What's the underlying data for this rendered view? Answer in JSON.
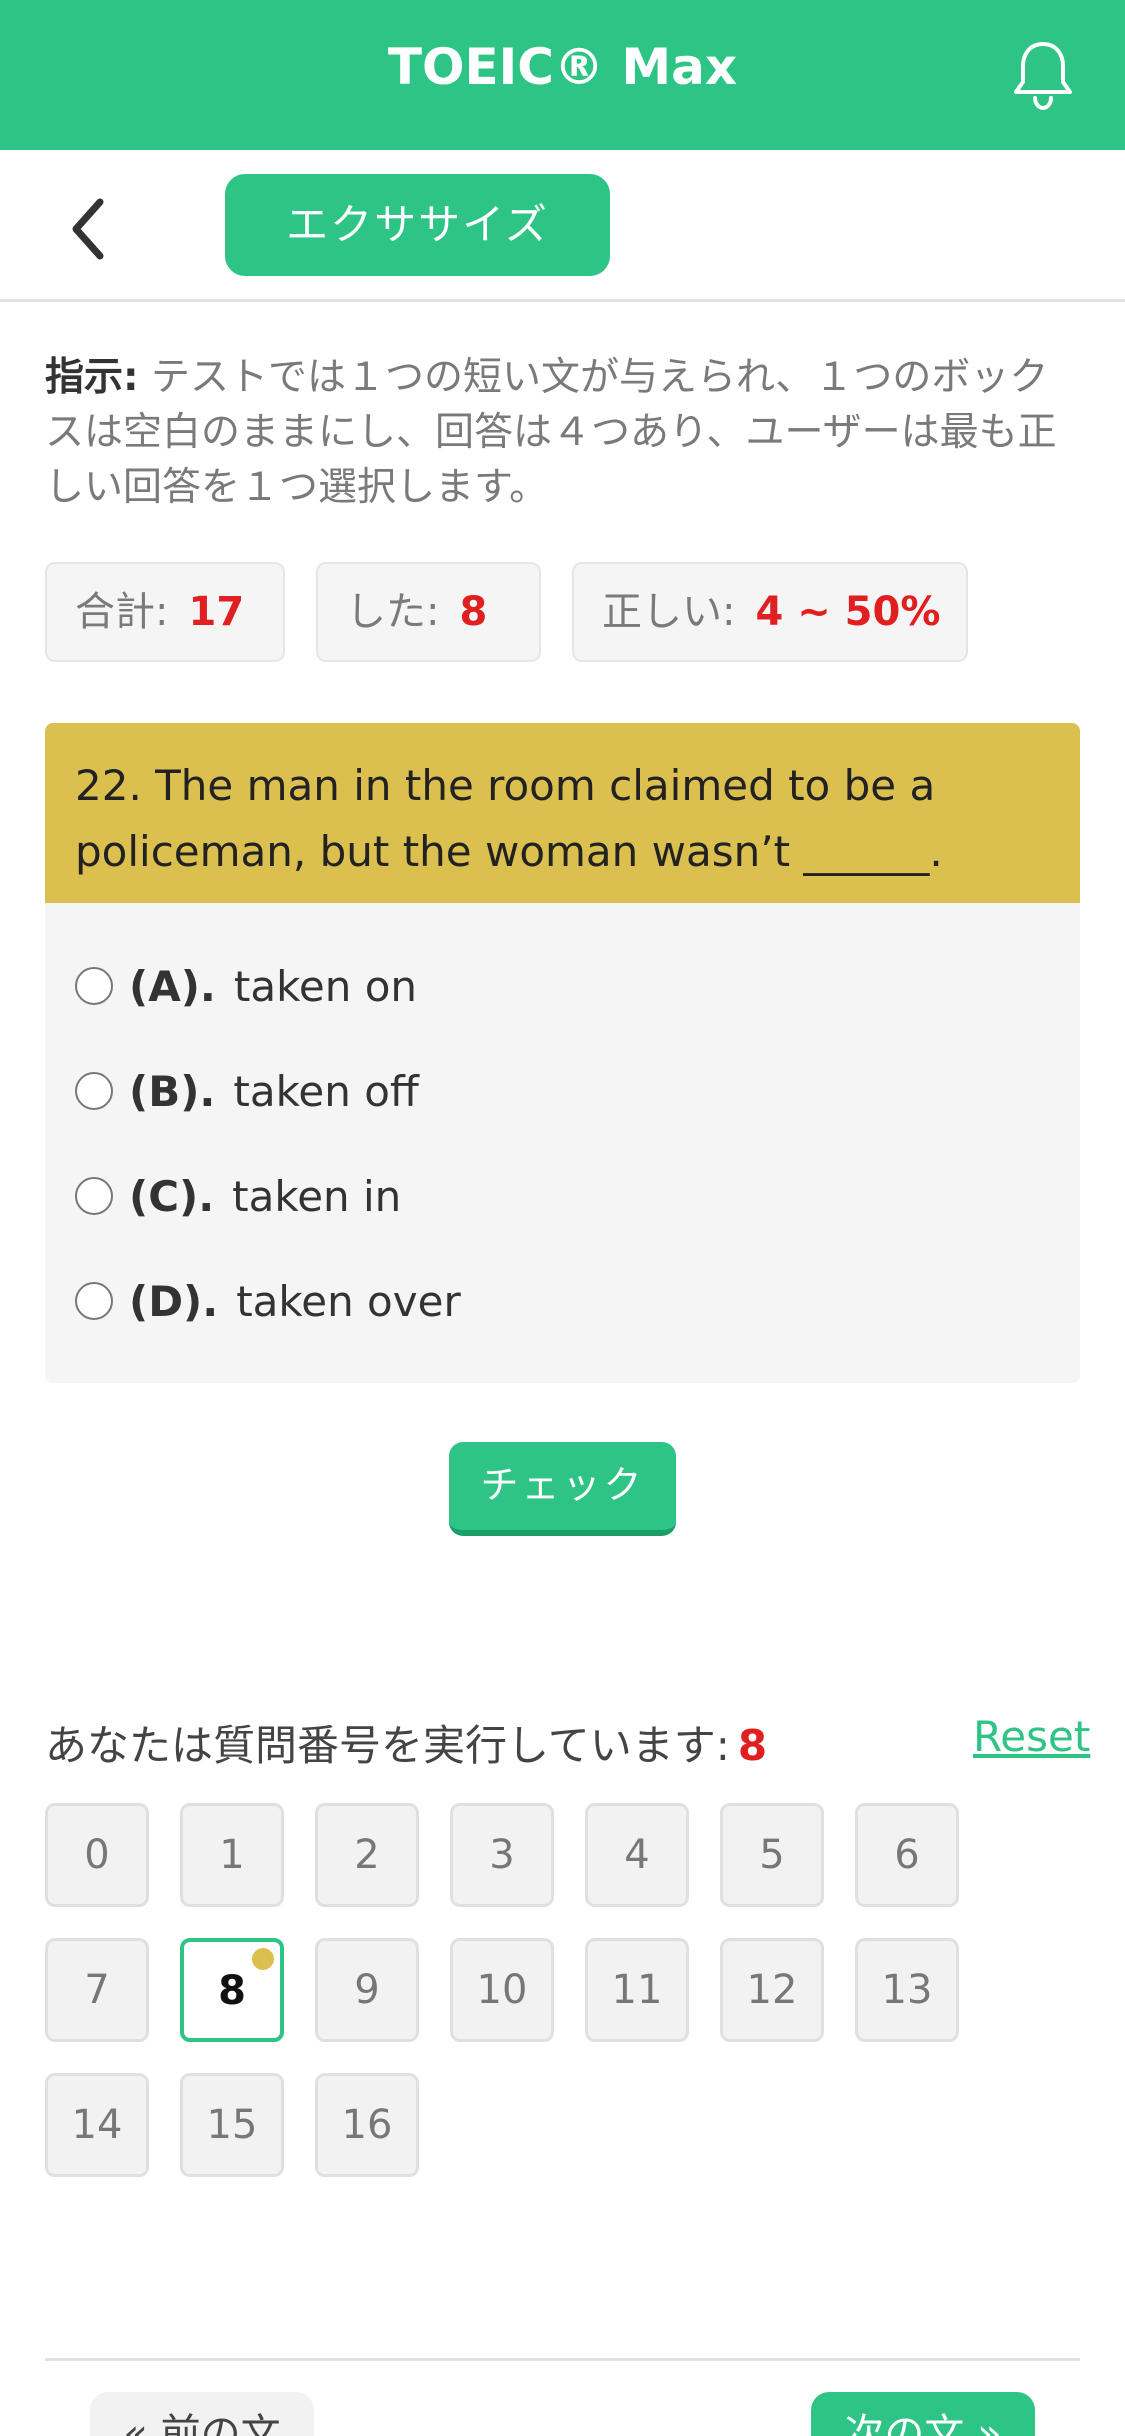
{
  "header": {
    "title": "TOEIC® Max",
    "icon": "bell-icon"
  },
  "subbar": {
    "back_icon": "chevron-left-icon",
    "mode_label": "エクササイズ"
  },
  "instructions": {
    "label": "指示:",
    "text": " テストでは１つの短い文が与えられ、１つのボックスは空白のままにし、回答は４つあり、ユーザーは最も正しい回答を１つ選択します。"
  },
  "stats": {
    "total_label": "合計:",
    "total_value": "17",
    "done_label": "した:",
    "done_value": "8",
    "correct_label": "正しい:",
    "correct_value": "4 ~ 50%"
  },
  "question": {
    "text": "22. The man in the room claimed to be a policeman, but the woman wasn’t ______.",
    "options": [
      {
        "label": "(A).",
        "text": "taken on"
      },
      {
        "label": "(B).",
        "text": "taken off"
      },
      {
        "label": "(C).",
        "text": "taken in"
      },
      {
        "label": "(D).",
        "text": "taken over"
      }
    ]
  },
  "check_label": "チェック",
  "progress": {
    "running_label": "あなたは質問番号を実行しています:",
    "current": "8",
    "reset_label": "Reset",
    "numbers": [
      "0",
      "1",
      "2",
      "3",
      "4",
      "5",
      "6",
      "7",
      "8",
      "9",
      "10",
      "11",
      "12",
      "13",
      "14",
      "15",
      "16"
    ]
  },
  "nav": {
    "prev_label": "« 前の文",
    "next_label": "次の文 »"
  },
  "colors": {
    "primary": "#2ec486",
    "question_header": "#dbbf4f",
    "accent_red": "#e02020"
  }
}
